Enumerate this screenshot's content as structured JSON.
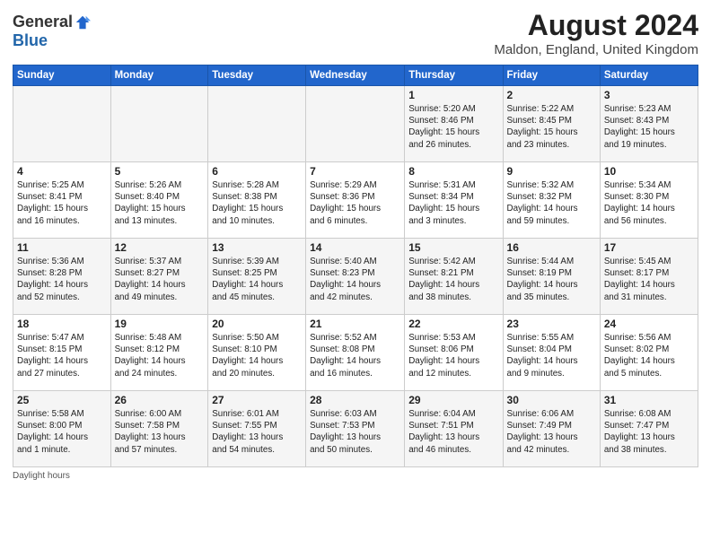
{
  "logo": {
    "general": "General",
    "blue": "Blue"
  },
  "title": "August 2024",
  "subtitle": "Maldon, England, United Kingdom",
  "header": {
    "days": [
      "Sunday",
      "Monday",
      "Tuesday",
      "Wednesday",
      "Thursday",
      "Friday",
      "Saturday"
    ]
  },
  "footer": "Daylight hours",
  "weeks": [
    [
      {
        "day": "",
        "info": ""
      },
      {
        "day": "",
        "info": ""
      },
      {
        "day": "",
        "info": ""
      },
      {
        "day": "",
        "info": ""
      },
      {
        "day": "1",
        "info": "Sunrise: 5:20 AM\nSunset: 8:46 PM\nDaylight: 15 hours\nand 26 minutes."
      },
      {
        "day": "2",
        "info": "Sunrise: 5:22 AM\nSunset: 8:45 PM\nDaylight: 15 hours\nand 23 minutes."
      },
      {
        "day": "3",
        "info": "Sunrise: 5:23 AM\nSunset: 8:43 PM\nDaylight: 15 hours\nand 19 minutes."
      }
    ],
    [
      {
        "day": "4",
        "info": "Sunrise: 5:25 AM\nSunset: 8:41 PM\nDaylight: 15 hours\nand 16 minutes."
      },
      {
        "day": "5",
        "info": "Sunrise: 5:26 AM\nSunset: 8:40 PM\nDaylight: 15 hours\nand 13 minutes."
      },
      {
        "day": "6",
        "info": "Sunrise: 5:28 AM\nSunset: 8:38 PM\nDaylight: 15 hours\nand 10 minutes."
      },
      {
        "day": "7",
        "info": "Sunrise: 5:29 AM\nSunset: 8:36 PM\nDaylight: 15 hours\nand 6 minutes."
      },
      {
        "day": "8",
        "info": "Sunrise: 5:31 AM\nSunset: 8:34 PM\nDaylight: 15 hours\nand 3 minutes."
      },
      {
        "day": "9",
        "info": "Sunrise: 5:32 AM\nSunset: 8:32 PM\nDaylight: 14 hours\nand 59 minutes."
      },
      {
        "day": "10",
        "info": "Sunrise: 5:34 AM\nSunset: 8:30 PM\nDaylight: 14 hours\nand 56 minutes."
      }
    ],
    [
      {
        "day": "11",
        "info": "Sunrise: 5:36 AM\nSunset: 8:28 PM\nDaylight: 14 hours\nand 52 minutes."
      },
      {
        "day": "12",
        "info": "Sunrise: 5:37 AM\nSunset: 8:27 PM\nDaylight: 14 hours\nand 49 minutes."
      },
      {
        "day": "13",
        "info": "Sunrise: 5:39 AM\nSunset: 8:25 PM\nDaylight: 14 hours\nand 45 minutes."
      },
      {
        "day": "14",
        "info": "Sunrise: 5:40 AM\nSunset: 8:23 PM\nDaylight: 14 hours\nand 42 minutes."
      },
      {
        "day": "15",
        "info": "Sunrise: 5:42 AM\nSunset: 8:21 PM\nDaylight: 14 hours\nand 38 minutes."
      },
      {
        "day": "16",
        "info": "Sunrise: 5:44 AM\nSunset: 8:19 PM\nDaylight: 14 hours\nand 35 minutes."
      },
      {
        "day": "17",
        "info": "Sunrise: 5:45 AM\nSunset: 8:17 PM\nDaylight: 14 hours\nand 31 minutes."
      }
    ],
    [
      {
        "day": "18",
        "info": "Sunrise: 5:47 AM\nSunset: 8:15 PM\nDaylight: 14 hours\nand 27 minutes."
      },
      {
        "day": "19",
        "info": "Sunrise: 5:48 AM\nSunset: 8:12 PM\nDaylight: 14 hours\nand 24 minutes."
      },
      {
        "day": "20",
        "info": "Sunrise: 5:50 AM\nSunset: 8:10 PM\nDaylight: 14 hours\nand 20 minutes."
      },
      {
        "day": "21",
        "info": "Sunrise: 5:52 AM\nSunset: 8:08 PM\nDaylight: 14 hours\nand 16 minutes."
      },
      {
        "day": "22",
        "info": "Sunrise: 5:53 AM\nSunset: 8:06 PM\nDaylight: 14 hours\nand 12 minutes."
      },
      {
        "day": "23",
        "info": "Sunrise: 5:55 AM\nSunset: 8:04 PM\nDaylight: 14 hours\nand 9 minutes."
      },
      {
        "day": "24",
        "info": "Sunrise: 5:56 AM\nSunset: 8:02 PM\nDaylight: 14 hours\nand 5 minutes."
      }
    ],
    [
      {
        "day": "25",
        "info": "Sunrise: 5:58 AM\nSunset: 8:00 PM\nDaylight: 14 hours\nand 1 minute."
      },
      {
        "day": "26",
        "info": "Sunrise: 6:00 AM\nSunset: 7:58 PM\nDaylight: 13 hours\nand 57 minutes."
      },
      {
        "day": "27",
        "info": "Sunrise: 6:01 AM\nSunset: 7:55 PM\nDaylight: 13 hours\nand 54 minutes."
      },
      {
        "day": "28",
        "info": "Sunrise: 6:03 AM\nSunset: 7:53 PM\nDaylight: 13 hours\nand 50 minutes."
      },
      {
        "day": "29",
        "info": "Sunrise: 6:04 AM\nSunset: 7:51 PM\nDaylight: 13 hours\nand 46 minutes."
      },
      {
        "day": "30",
        "info": "Sunrise: 6:06 AM\nSunset: 7:49 PM\nDaylight: 13 hours\nand 42 minutes."
      },
      {
        "day": "31",
        "info": "Sunrise: 6:08 AM\nSunset: 7:47 PM\nDaylight: 13 hours\nand 38 minutes."
      }
    ]
  ]
}
